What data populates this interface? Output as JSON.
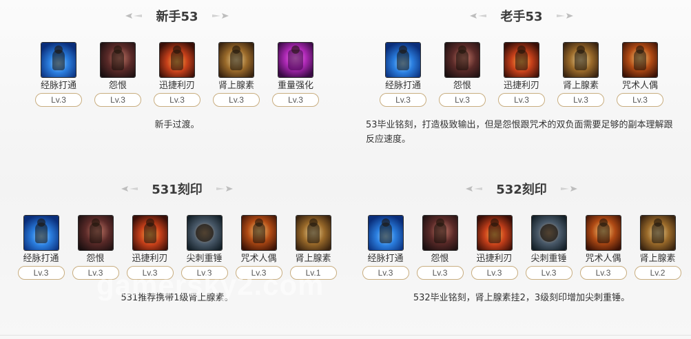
{
  "panels": [
    {
      "title": "新手53",
      "skills": [
        {
          "name": "经脉打通",
          "level": "Lv.3",
          "icon": "meridian-icon"
        },
        {
          "name": "怨恨",
          "level": "Lv.3",
          "icon": "grudge-icon"
        },
        {
          "name": "迅捷利刃",
          "level": "Lv.3",
          "icon": "swift-blade-icon"
        },
        {
          "name": "肾上腺素",
          "level": "Lv.3",
          "icon": "adrenaline-icon"
        },
        {
          "name": "重量强化",
          "level": "Lv.3",
          "icon": "weight-reinforce-icon"
        }
      ],
      "note": "新手过渡。"
    },
    {
      "title": "老手53",
      "skills": [
        {
          "name": "经脉打通",
          "level": "Lv.3",
          "icon": "meridian-icon"
        },
        {
          "name": "怨恨",
          "level": "Lv.3",
          "icon": "grudge-icon"
        },
        {
          "name": "迅捷利刃",
          "level": "Lv.3",
          "icon": "swift-blade-icon"
        },
        {
          "name": "肾上腺素",
          "level": "Lv.3",
          "icon": "adrenaline-icon"
        },
        {
          "name": "咒术人偶",
          "level": "Lv.3",
          "icon": "curse-doll-icon"
        }
      ],
      "note": "53毕业铭刻，打造极致输出，但是怨恨跟咒术的双负面需要足够的副本理解跟反应速度。"
    },
    {
      "title": "531刻印",
      "skills": [
        {
          "name": "经脉打通",
          "level": "Lv.3",
          "icon": "meridian-icon"
        },
        {
          "name": "怨恨",
          "level": "Lv.3",
          "icon": "grudge-icon"
        },
        {
          "name": "迅捷利刃",
          "level": "Lv.3",
          "icon": "swift-blade-icon"
        },
        {
          "name": "尖刺重锤",
          "level": "Lv.3",
          "icon": "spiked-hammer-icon"
        },
        {
          "name": "咒术人偶",
          "level": "Lv.3",
          "icon": "curse-doll-icon"
        },
        {
          "name": "肾上腺素",
          "level": "Lv.1",
          "icon": "adrenaline-icon"
        }
      ],
      "note": "531推荐携带1级肾上腺素。"
    },
    {
      "title": "532刻印",
      "skills": [
        {
          "name": "经脉打通",
          "level": "Lv.3",
          "icon": "meridian-icon"
        },
        {
          "name": "怨恨",
          "level": "Lv.3",
          "icon": "grudge-icon"
        },
        {
          "name": "迅捷利刃",
          "level": "Lv.3",
          "icon": "swift-blade-icon"
        },
        {
          "name": "尖刺重锤",
          "level": "Lv.3",
          "icon": "spiked-hammer-icon"
        },
        {
          "name": "咒术人偶",
          "level": "Lv.3",
          "icon": "curse-doll-icon"
        },
        {
          "name": "肾上腺素",
          "level": "Lv.2",
          "icon": "adrenaline-icon"
        }
      ],
      "note": "532毕业铭刻，肾上腺素挂2，3级刻印增加尖刺重锤。"
    }
  ],
  "watermark": "gamersky2.com"
}
